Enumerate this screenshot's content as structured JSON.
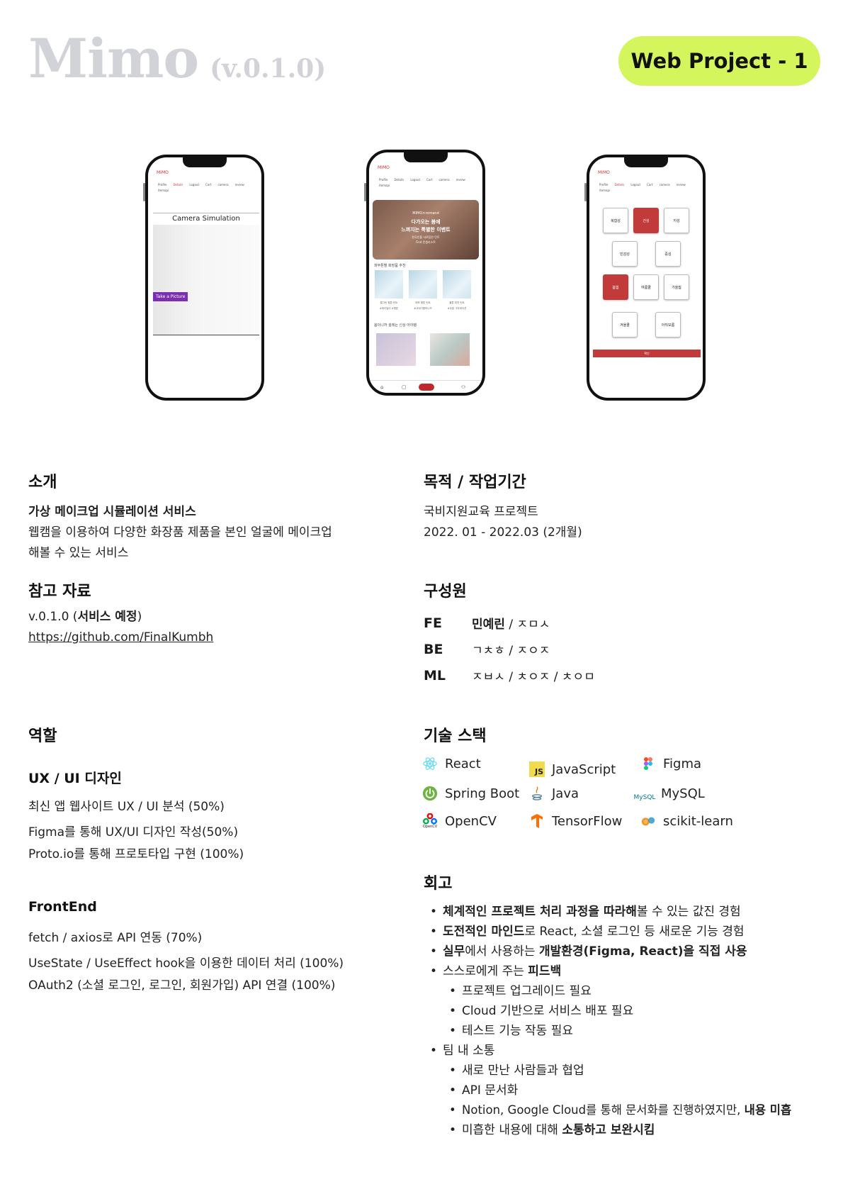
{
  "header": {
    "title": "Mimo",
    "version": "(v.0.1.0)",
    "badge": "Web Project - 1"
  },
  "phones": {
    "logo": "MIMO",
    "nav": [
      "Profile",
      "Details",
      "Logout",
      "Cart",
      "camera",
      "review",
      "itemapi"
    ],
    "phone1": {
      "title": "Camera Simulation",
      "button": "Take a Picture"
    },
    "phone2": {
      "hero_brand": "MIMO×romand",
      "hero_title1": "다가오는 봄에",
      "hero_title2": "느껴지는 특별한 이벤트",
      "hero_sub1": "한국인을 사로잡은 틴트",
      "hero_sub2": "Find 컨셉리스트",
      "section1": "피부톤별 화장품 추천",
      "products": [
        "월그린 웜톤 틴트",
        "레포 웜톤 틴트",
        "쿨톤 피치 틴트"
      ],
      "product_tags": [
        "#데이일리 #웜톤",
        "#고데기용미니즈",
        "#무광 그라데이션"
      ],
      "section2": "봄이니까 설레는 신상 아이템"
    },
    "phone3": {
      "tones": [
        "복합성",
        "건성",
        "지성",
        "민감성",
        "중성",
        "봄웜",
        "여름쿨",
        "가을웜",
        "겨울쿨",
        "아직모름"
      ],
      "submit": "확인"
    }
  },
  "intro": {
    "heading": "소개",
    "title": "가상 메이크업 시뮬레이션 서비스",
    "desc_line1": "웹캠을 이용하여 다양한 화장품 제품을 본인 얼굴에 메이크업",
    "desc_line2": "해볼 수 있는 서비스"
  },
  "purpose": {
    "heading": "목적 / 작업기간",
    "line1": "국비지원교육 프로젝트",
    "line2": "2022. 01  -  2022.03 (2개월)"
  },
  "reference": {
    "heading": "참고 자료",
    "version_text": "v.0.1.0 (",
    "version_bold": "서비스 예정",
    "version_close": ")",
    "link": "https://github.com/FinalKumbh"
  },
  "members": {
    "heading": "구성원",
    "rows": [
      {
        "role": "FE",
        "name_bold": "민예린",
        "others": " / ㅈㅁㅅ"
      },
      {
        "role": "BE",
        "name_bold": "",
        "others": "ㄱㅊㅎ / ㅈㅇㅈ"
      },
      {
        "role": "ML",
        "name_bold": "",
        "others": "ㅈㅂㅅ / ㅊㅇㅈ / ㅊㅇㅁ"
      }
    ]
  },
  "roles": {
    "heading": "역할",
    "uxui": {
      "title": "UX / UI 디자인",
      "items": [
        "최신 앱 웹사이트 UX / UI 분석 (50%)",
        "Figma를 통해 UX/UI 디자인 작성(50%)",
        "Proto.io를 통해 프로토타입 구현 (100%)"
      ]
    },
    "frontend": {
      "title": "FrontEnd",
      "items": [
        "fetch / axios로 API 연동 (70%)",
        "UseState / UseEffect hook을 이용한 데이터 처리 (100%)",
        "OAuth2 (소셜 로그인, 로그인, 회원가입) API 연결 (100%)"
      ]
    }
  },
  "stack": {
    "heading": "기술 스택",
    "items": [
      {
        "name": "React",
        "icon": "react-icon",
        "color": "#61dafb"
      },
      {
        "name": "JavaScript",
        "icon": "javascript-icon",
        "color": "#f0db4f"
      },
      {
        "name": "Figma",
        "icon": "figma-icon",
        "color": "#f24e1e"
      },
      {
        "name": "Spring Boot",
        "icon": "spring-boot-icon",
        "color": "#6db33f"
      },
      {
        "name": "Java",
        "icon": "java-icon",
        "color": "#5382a1"
      },
      {
        "name": "MySQL",
        "icon": "mysql-icon",
        "color": "#00758f"
      },
      {
        "name": "OpenCV",
        "icon": "opencv-icon",
        "color": "#5c3ee8"
      },
      {
        "name": "TensorFlow",
        "icon": "tensorflow-icon",
        "color": "#ff6f00"
      },
      {
        "name": "scikit-learn",
        "icon": "scikit-learn-icon",
        "color": "#f7931e"
      }
    ],
    "opencv_caption": "OpenCV",
    "mysql_caption": "MySQL",
    "js_caption": "JS"
  },
  "retro": {
    "heading": "회고",
    "b1_bold": "체계적인 프로젝트 처리 과정을 따라해",
    "b1_rest": "볼 수 있는 값진 경험",
    "b2_bold": "도전적인 마인드",
    "b2_rest": "로 React, 소셜 로그인 등 새로운 기능 경험",
    "b3_bold1": "실무",
    "b3_mid": "에서 사용하는 ",
    "b3_bold2": "개발환경(Figma, React)을 직접 사용",
    "b4_rest": "스스로에게 주는 ",
    "b4_bold": "피드백",
    "b4_subs": [
      "프로젝트 업그레이드 필요",
      "Cloud 기반으로 서비스 배포 필요",
      "테스트 기능 작동 필요"
    ],
    "b5": "팀 내 소통",
    "b5_subs": [
      "새로 만난 사람들과 협업",
      "API 문서화"
    ],
    "b5_sub3_rest": "Notion, Google Cloud를 통해 문서화를 진행하였지만, ",
    "b5_sub3_bold": "내용 미흡",
    "b5_sub4_rest": "미흡한 내용에 대해 ",
    "b5_sub4_bold": "소통하고 보완시킴"
  }
}
